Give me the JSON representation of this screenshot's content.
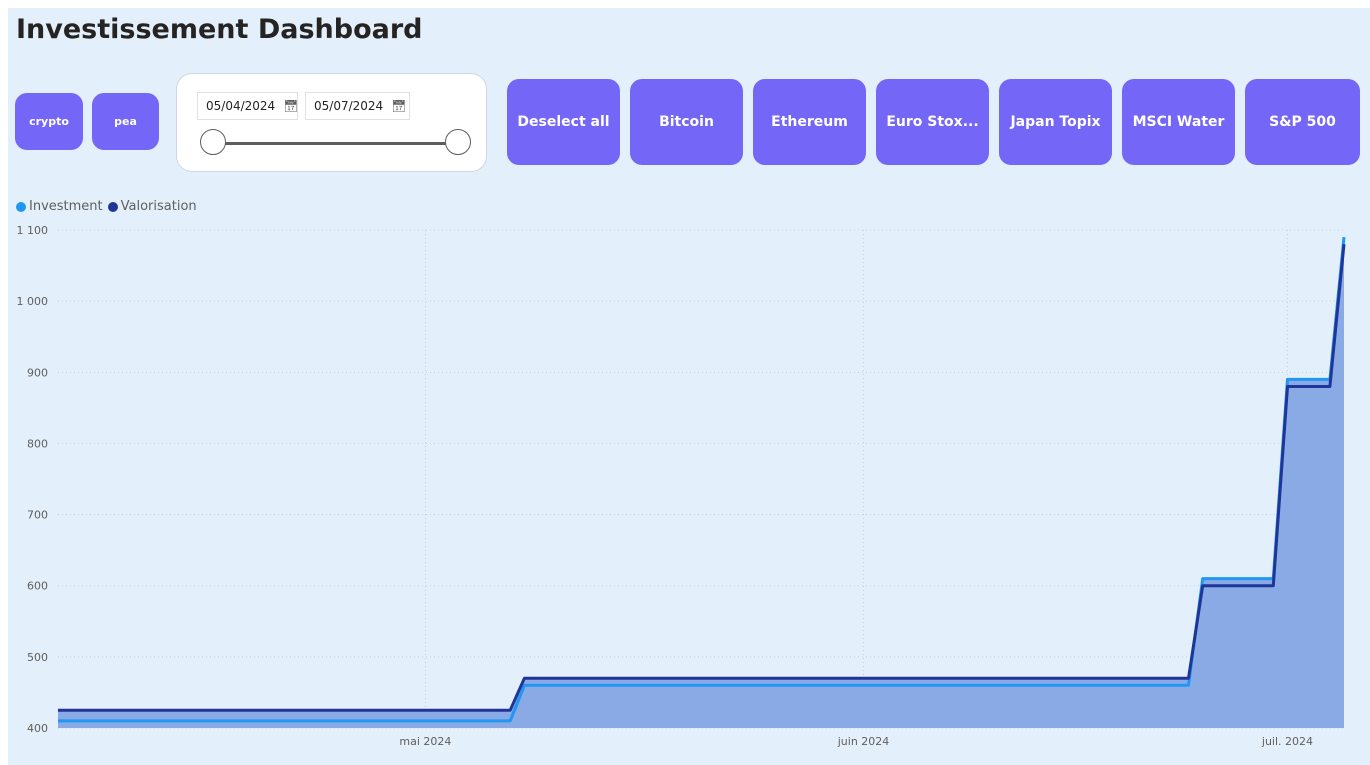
{
  "title": "Investissement Dashboard",
  "category_buttons": [
    {
      "label": "crypto"
    },
    {
      "label": "pea"
    }
  ],
  "date_slicer": {
    "start": "05/04/2024",
    "end": "05/07/2024",
    "calendar_icon": "calendar-icon"
  },
  "asset_buttons": [
    {
      "label": "Deselect all"
    },
    {
      "label": "Bitcoin"
    },
    {
      "label": "Ethereum"
    },
    {
      "label": "Euro Stox..."
    },
    {
      "label": "Japan Topix"
    },
    {
      "label": "MSCI Water"
    },
    {
      "label": "S&P 500"
    }
  ],
  "colors": {
    "accent_button": "#7466f6",
    "investment": "#2196f3",
    "valorisation": "#1f3597",
    "area_fill": "#8aaae6",
    "background": "#e3f0fc"
  },
  "chart_data": {
    "type": "area",
    "legend": [
      "Investment",
      "Valorisation"
    ],
    "legend_position": "top-left",
    "x_tick_labels": [
      "mai 2024",
      "juin 2024",
      "juil. 2024"
    ],
    "y_tick_labels": [
      "400",
      "500",
      "600",
      "700",
      "800",
      "900",
      "1 000",
      "1 100"
    ],
    "ylim": [
      400,
      1100
    ],
    "grid": true,
    "x_range": [
      "2024-04-05",
      "2024-07-05"
    ],
    "series": [
      {
        "name": "Investment",
        "points": [
          [
            "2024-04-05",
            410
          ],
          [
            "2024-05-07",
            410
          ],
          [
            "2024-05-08",
            460
          ],
          [
            "2024-06-24",
            460
          ],
          [
            "2024-06-25",
            610
          ],
          [
            "2024-06-30",
            610
          ],
          [
            "2024-07-01",
            890
          ],
          [
            "2024-07-04",
            890
          ],
          [
            "2024-07-05",
            1090
          ]
        ]
      },
      {
        "name": "Valorisation",
        "points": [
          [
            "2024-04-05",
            425
          ],
          [
            "2024-05-07",
            425
          ],
          [
            "2024-05-08",
            470
          ],
          [
            "2024-06-24",
            470
          ],
          [
            "2024-06-25",
            600
          ],
          [
            "2024-06-30",
            600
          ],
          [
            "2024-07-01",
            880
          ],
          [
            "2024-07-04",
            880
          ],
          [
            "2024-07-05",
            1080
          ]
        ]
      }
    ]
  }
}
